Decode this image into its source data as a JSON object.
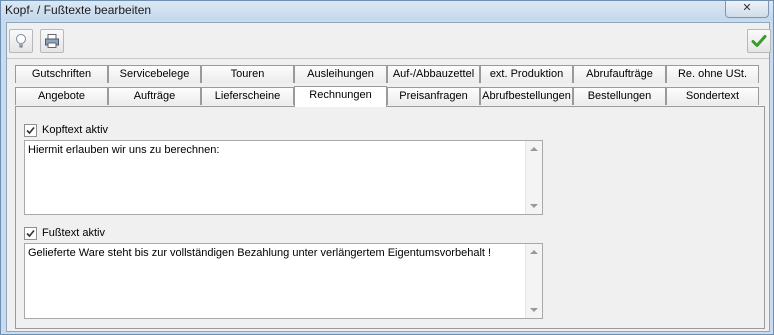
{
  "window": {
    "title": "Kopf- / Fußtexte bearbeiten",
    "close_label": "✕"
  },
  "toolbar": {
    "hint_icon": "lightbulb-icon",
    "print_icon": "printer-icon",
    "confirm_icon": "checkmark-icon"
  },
  "tabs": {
    "row1": [
      "Gutschriften",
      "Servicebelege",
      "Touren",
      "Ausleihungen",
      "Auf-/Abbauzettel",
      "ext. Produktion",
      "Abrufaufträge",
      "Re. ohne USt."
    ],
    "row2": [
      "Angebote",
      "Aufträge",
      "Lieferscheine",
      "Rechnungen",
      "Preisanfragen",
      "Abrufbestellungen",
      "Bestellungen",
      "Sondertext"
    ],
    "active": "Rechnungen"
  },
  "header": {
    "checkbox_label": "Kopftext aktiv",
    "checked": true,
    "text": "Hiermit erlauben wir uns zu berechnen:"
  },
  "footer": {
    "checkbox_label": "Fußtext aktiv",
    "checked": true,
    "text": "Gelieferte Ware steht bis zur vollständigen Bezahlung unter verlängertem Eigentumsvorbehalt !"
  },
  "colors": {
    "window_frame": "#c9dbee",
    "checkmark_green": "#3a9a2a"
  }
}
